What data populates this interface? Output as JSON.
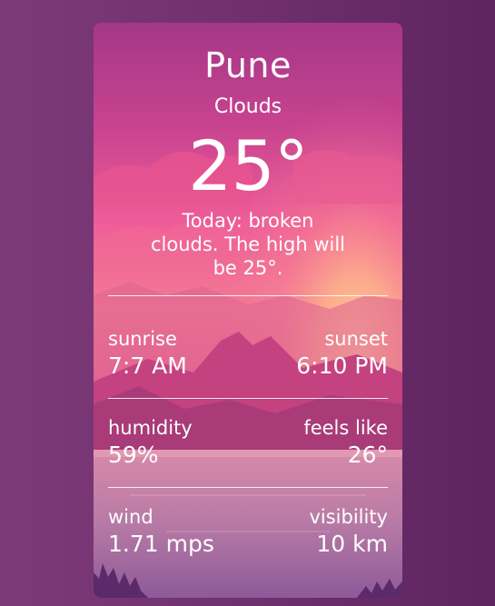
{
  "weather": {
    "city": "Pune",
    "condition": "Clouds",
    "temperature": "25°",
    "summary": "Today: broken clouds. The high will be 25°."
  },
  "stats": {
    "sunrise": {
      "label": "sunrise",
      "value": "7:7 AM"
    },
    "sunset": {
      "label": "sunset",
      "value": "6:10 PM"
    },
    "humidity": {
      "label": "humidity",
      "value": "59%"
    },
    "feels_like": {
      "label": "feels like",
      "value": "26°"
    },
    "wind": {
      "label": "wind",
      "value": "1.71 mps"
    },
    "visibility": {
      "label": "visibility",
      "value": "10 km"
    }
  },
  "colors": {
    "page_background": "#6e2f6c",
    "card_top": "#c2418a",
    "card_mid": "#ee5a9a",
    "sun_glow": "#ffc08c",
    "mountains": "#b83b7a",
    "water": "#c98aa6"
  }
}
